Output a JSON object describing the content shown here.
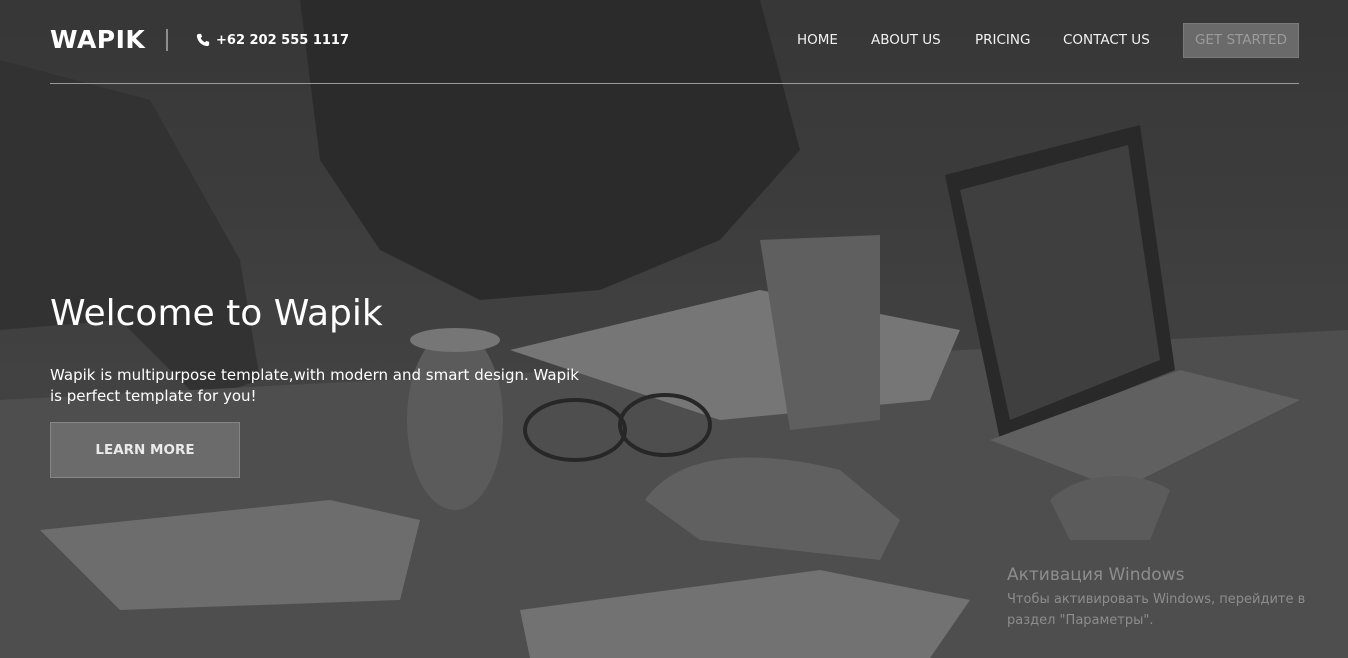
{
  "header": {
    "logo": "WAPIK",
    "phone": "+62 202 555 1117",
    "phone_icon": "phone-icon",
    "nav": {
      "home": "HOME",
      "about": "ABOUT US",
      "pricing": "PRICING",
      "contact": "CONTACT US"
    },
    "cta": "GET STARTED"
  },
  "hero": {
    "title": "Welcome to Wapik",
    "text": "Wapik is multipurpose template,with modern and smart design. Wapik is perfect template for you!",
    "button": "LEARN MORE"
  },
  "watermark": {
    "title": "Активация Windows",
    "subtitle": "Чтобы активировать Windows, перейдите в раздел \"Параметры\"."
  },
  "colors": {
    "overlay": "#4a4a4a",
    "text": "#ffffff",
    "cta_bg": "#6a6a6a"
  }
}
